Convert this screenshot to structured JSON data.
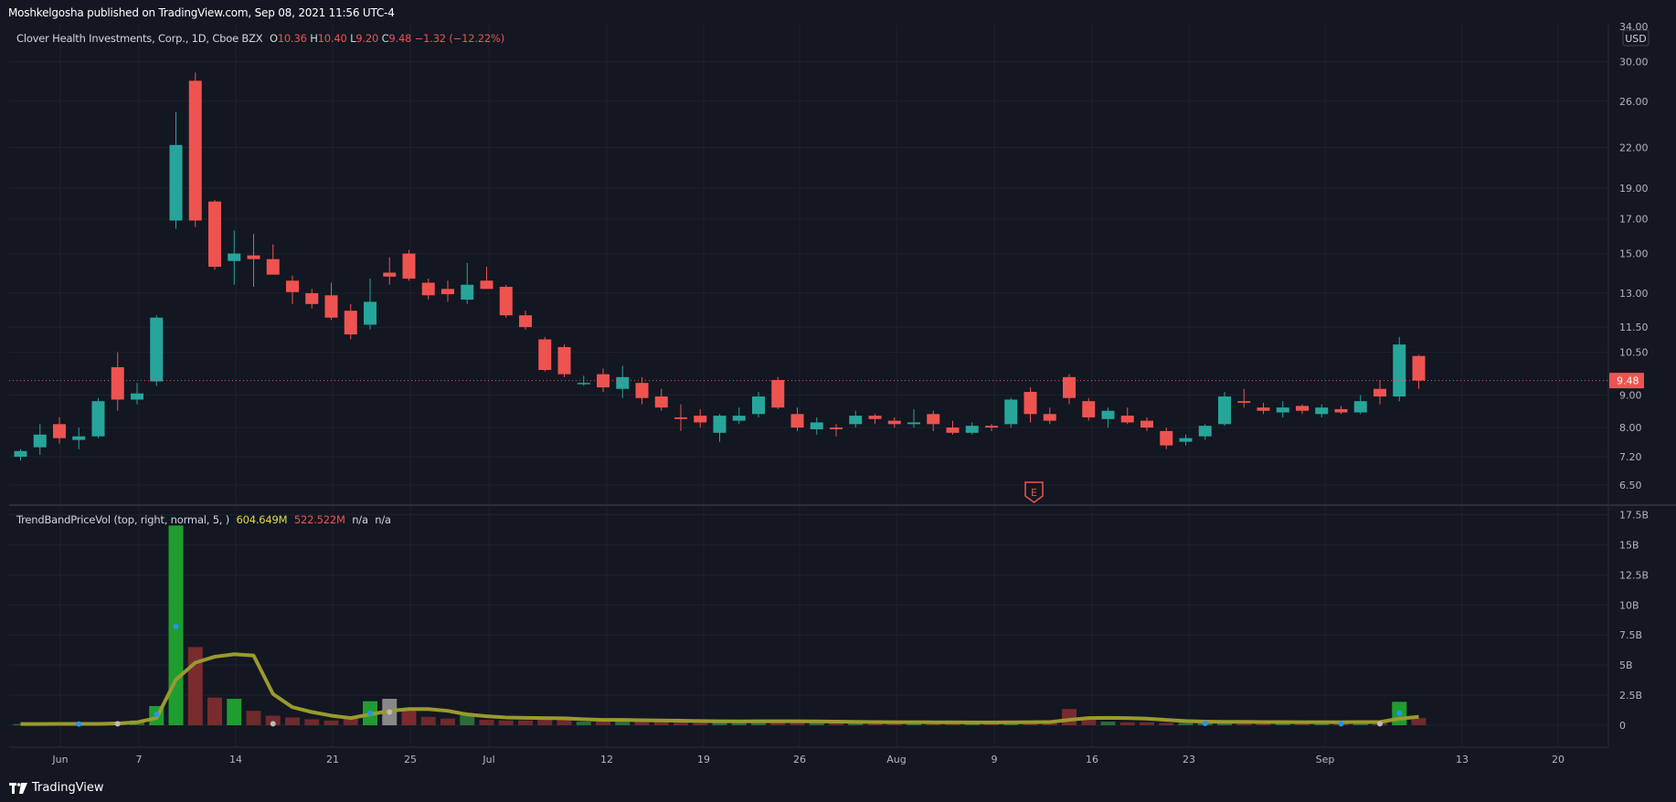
{
  "header": {
    "published": "Moshkelgosha published on TradingView.com, Sep 08, 2021 11:56 UTC-4"
  },
  "footer": {
    "brand": "TradingView"
  },
  "symbol_legend": {
    "name": "Clover Health Investments, Corp., 1D, Cboe BZX",
    "o_label": "O",
    "o_value": "10.36",
    "h_label": "H",
    "h_value": "10.40",
    "l_label": "L",
    "l_value": "9.20",
    "c_label": "C",
    "c_value": "9.48",
    "change": "−1.32 (−12.22%)"
  },
  "indicator_legend": {
    "name": "TrendBandPriceVol (top, right, normal, 5, )",
    "v1": "604.649M",
    "v2": "522.522M",
    "v3": "n/a",
    "v4": "n/a"
  },
  "price_axis": {
    "currency": "USD",
    "last_price": "9.48",
    "scale": "log",
    "top_partial": "34.00",
    "ticks": [
      "30.00",
      "26.00",
      "22.00",
      "19.00",
      "17.00",
      "15.00",
      "13.00",
      "11.50",
      "10.50",
      "9.00",
      "8.00",
      "7.20",
      "6.50"
    ]
  },
  "volume_axis": {
    "ticks": [
      "17.5B",
      "15B",
      "12.5B",
      "10B",
      "7.5B",
      "5B",
      "2.5B",
      "0"
    ]
  },
  "time_axis": {
    "labels": [
      "Jun",
      "7",
      "14",
      "21",
      "25",
      "Jul",
      "12",
      "19",
      "26",
      "Aug",
      "9",
      "16",
      "23",
      "Sep",
      "13",
      "20"
    ]
  },
  "earnings_marker": "E",
  "colors": {
    "up": "#26a69a",
    "down": "#ef5350",
    "bg": "#131722",
    "grid": "#1e222d",
    "trend": "#9a9a2e"
  },
  "chart_data": {
    "type": "candlestick",
    "title": "Clover Health Investments, Corp., 1D, Cboe BZX",
    "y_scale": "log",
    "ylim": [
      6.2,
      34.5
    ],
    "x": [
      "2021-05-28",
      "2021-06-01",
      "2021-06-02",
      "2021-06-03",
      "2021-06-04",
      "2021-06-07",
      "2021-06-08",
      "2021-06-09",
      "2021-06-10",
      "2021-06-11",
      "2021-06-14",
      "2021-06-15",
      "2021-06-16",
      "2021-06-17",
      "2021-06-18",
      "2021-06-21",
      "2021-06-22",
      "2021-06-23",
      "2021-06-24",
      "2021-06-25",
      "2021-06-28",
      "2021-06-29",
      "2021-06-30",
      "2021-07-01",
      "2021-07-02",
      "2021-07-06",
      "2021-07-07",
      "2021-07-08",
      "2021-07-09",
      "2021-07-12",
      "2021-07-13",
      "2021-07-14",
      "2021-07-15",
      "2021-07-16",
      "2021-07-19",
      "2021-07-20",
      "2021-07-21",
      "2021-07-22",
      "2021-07-23",
      "2021-07-26",
      "2021-07-27",
      "2021-07-28",
      "2021-07-29",
      "2021-07-30",
      "2021-08-02",
      "2021-08-03",
      "2021-08-04",
      "2021-08-05",
      "2021-08-06",
      "2021-08-09",
      "2021-08-10",
      "2021-08-11",
      "2021-08-12",
      "2021-08-13",
      "2021-08-16",
      "2021-08-17",
      "2021-08-18",
      "2021-08-19",
      "2021-08-20",
      "2021-08-23",
      "2021-08-24",
      "2021-08-25",
      "2021-08-26",
      "2021-08-27",
      "2021-08-30",
      "2021-08-31",
      "2021-09-01",
      "2021-09-02",
      "2021-09-03",
      "2021-09-07"
    ],
    "ohlc": [
      [
        7.2,
        7.4,
        7.1,
        7.35
      ],
      [
        7.45,
        8.1,
        7.25,
        7.8
      ],
      [
        8.1,
        8.3,
        7.55,
        7.7
      ],
      [
        7.65,
        8.0,
        7.4,
        7.75
      ],
      [
        7.75,
        8.9,
        7.7,
        8.8
      ],
      [
        9.95,
        10.5,
        8.5,
        8.85
      ],
      [
        8.85,
        9.4,
        8.7,
        9.05
      ],
      [
        9.45,
        12.0,
        9.3,
        11.9
      ],
      [
        16.9,
        25.0,
        16.4,
        22.2
      ],
      [
        28.0,
        28.85,
        16.5,
        16.9
      ],
      [
        18.1,
        18.2,
        14.15,
        14.3
      ],
      [
        14.6,
        16.3,
        13.4,
        15.0
      ],
      [
        14.9,
        16.1,
        13.3,
        14.7
      ],
      [
        14.7,
        15.5,
        13.9,
        13.9
      ],
      [
        13.6,
        13.85,
        12.5,
        13.05
      ],
      [
        13.0,
        13.2,
        12.3,
        12.5
      ],
      [
        12.9,
        13.5,
        11.8,
        11.9
      ],
      [
        12.2,
        12.5,
        11.0,
        11.2
      ],
      [
        11.6,
        13.7,
        11.4,
        12.6
      ],
      [
        14.0,
        14.8,
        13.4,
        13.8
      ],
      [
        15.0,
        15.2,
        13.6,
        13.7
      ],
      [
        13.5,
        13.7,
        12.7,
        12.9
      ],
      [
        13.2,
        13.6,
        12.6,
        12.95
      ],
      [
        12.7,
        14.5,
        12.5,
        13.4
      ],
      [
        13.6,
        14.3,
        13.2,
        13.2
      ],
      [
        13.3,
        13.4,
        11.9,
        12.0
      ],
      [
        12.0,
        12.2,
        11.4,
        11.5
      ],
      [
        11.0,
        11.1,
        9.8,
        9.85
      ],
      [
        10.7,
        10.8,
        9.6,
        9.7
      ],
      [
        9.4,
        9.65,
        9.3,
        9.4
      ],
      [
        9.7,
        9.9,
        9.1,
        9.25
      ],
      [
        9.2,
        10.0,
        8.9,
        9.6
      ],
      [
        9.4,
        9.6,
        8.7,
        8.9
      ],
      [
        8.95,
        9.2,
        8.5,
        8.6
      ],
      [
        8.3,
        8.7,
        7.9,
        8.25
      ],
      [
        8.35,
        8.55,
        8.0,
        8.15
      ],
      [
        7.85,
        8.4,
        7.6,
        8.35
      ],
      [
        8.2,
        8.6,
        8.1,
        8.35
      ],
      [
        8.4,
        9.1,
        8.3,
        8.95
      ],
      [
        9.5,
        9.6,
        8.55,
        8.6
      ],
      [
        8.4,
        8.6,
        7.9,
        8.0
      ],
      [
        7.95,
        8.3,
        7.8,
        8.15
      ],
      [
        8.0,
        8.1,
        7.75,
        7.95
      ],
      [
        8.1,
        8.5,
        8.0,
        8.35
      ],
      [
        8.35,
        8.4,
        8.1,
        8.25
      ],
      [
        8.2,
        8.3,
        8.0,
        8.1
      ],
      [
        8.1,
        8.55,
        8.0,
        8.15
      ],
      [
        8.4,
        8.5,
        7.9,
        8.1
      ],
      [
        8.0,
        8.2,
        7.8,
        7.85
      ],
      [
        7.85,
        8.15,
        7.8,
        8.05
      ],
      [
        8.05,
        8.1,
        7.9,
        8.0
      ],
      [
        8.1,
        8.9,
        8.0,
        8.85
      ],
      [
        9.1,
        9.25,
        8.15,
        8.4
      ],
      [
        8.4,
        8.6,
        8.1,
        8.2
      ],
      [
        9.6,
        9.7,
        8.7,
        8.9
      ],
      [
        8.8,
        8.9,
        8.2,
        8.3
      ],
      [
        8.25,
        8.6,
        8.0,
        8.5
      ],
      [
        8.35,
        8.6,
        8.1,
        8.15
      ],
      [
        8.2,
        8.3,
        7.9,
        8.0
      ],
      [
        7.9,
        8.0,
        7.4,
        7.5
      ],
      [
        7.6,
        7.8,
        7.5,
        7.7
      ],
      [
        7.75,
        8.1,
        7.65,
        8.05
      ],
      [
        8.1,
        9.1,
        8.05,
        8.95
      ],
      [
        8.8,
        9.2,
        8.6,
        8.75
      ],
      [
        8.6,
        8.75,
        8.4,
        8.5
      ],
      [
        8.45,
        8.8,
        8.3,
        8.6
      ],
      [
        8.65,
        8.7,
        8.4,
        8.5
      ],
      [
        8.4,
        8.7,
        8.3,
        8.6
      ],
      [
        8.55,
        8.65,
        8.4,
        8.45
      ],
      [
        8.45,
        9.0,
        8.4,
        8.8
      ],
      [
        9.2,
        9.5,
        8.7,
        8.95
      ],
      [
        8.95,
        11.1,
        8.8,
        10.8
      ],
      [
        10.36,
        10.4,
        9.2,
        9.48
      ]
    ],
    "volume_unit": "B",
    "volume_ylim": [
      0,
      17.5
    ],
    "volume": [
      0.1,
      0.1,
      0.12,
      0.1,
      0.12,
      0.3,
      0.4,
      1.6,
      16.6,
      6.5,
      2.3,
      2.2,
      1.2,
      0.8,
      0.65,
      0.5,
      0.4,
      0.6,
      2.0,
      2.2,
      1.4,
      0.7,
      0.55,
      1.0,
      0.45,
      0.4,
      0.4,
      0.7,
      0.45,
      0.3,
      0.3,
      0.45,
      0.35,
      0.3,
      0.25,
      0.2,
      0.35,
      0.2,
      0.3,
      0.35,
      0.3,
      0.25,
      0.2,
      0.2,
      0.2,
      0.2,
      0.2,
      0.25,
      0.2,
      0.15,
      0.2,
      0.3,
      0.35,
      0.2,
      1.35,
      0.5,
      0.3,
      0.25,
      0.25,
      0.2,
      0.2,
      0.25,
      0.3,
      0.25,
      0.2,
      0.2,
      0.2,
      0.2,
      0.25,
      0.3,
      0.3,
      1.95,
      0.6
    ],
    "trend_line": [
      0.1,
      0.1,
      0.11,
      0.11,
      0.11,
      0.15,
      0.25,
      0.6,
      3.8,
      5.2,
      5.7,
      5.9,
      5.8,
      2.6,
      1.5,
      1.1,
      0.8,
      0.6,
      0.9,
      1.2,
      1.35,
      1.35,
      1.2,
      0.9,
      0.75,
      0.65,
      0.62,
      0.6,
      0.58,
      0.5,
      0.45,
      0.45,
      0.42,
      0.4,
      0.38,
      0.35,
      0.33,
      0.32,
      0.33,
      0.33,
      0.33,
      0.32,
      0.3,
      0.28,
      0.27,
      0.26,
      0.26,
      0.25,
      0.25,
      0.24,
      0.24,
      0.25,
      0.26,
      0.27,
      0.45,
      0.6,
      0.62,
      0.6,
      0.55,
      0.45,
      0.35,
      0.3,
      0.28,
      0.28,
      0.27,
      0.27,
      0.26,
      0.26,
      0.26,
      0.27,
      0.27,
      0.55,
      0.7
    ],
    "series_count": 2
  }
}
